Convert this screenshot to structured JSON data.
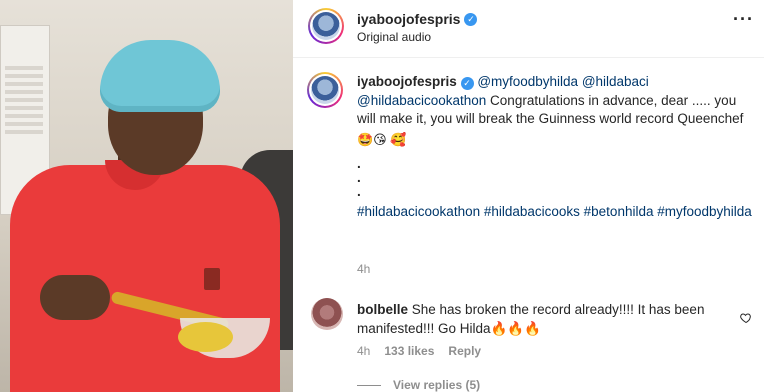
{
  "header": {
    "username": "iyaboojofespris",
    "audio_label": "Original audio",
    "more_label": "···"
  },
  "caption": {
    "username": "iyaboojofespris",
    "mentions": "@myfoodbyhilda @hildabaci @hildabacicookathon",
    "text": " Congratulations in advance, dear ..... you will make it, you will break the Guinness world record Queenchef",
    "emojis": "🤩😘 🥰",
    "dots": [
      ".",
      ".",
      "."
    ],
    "hashtags": "#hildabacicookathon #hildabacicooks #betonhilda #myfoodbyhilda",
    "time": "4h"
  },
  "comment": {
    "username": "bolbelle",
    "text": " She has broken the record already!!!! It has been manifested!!! Go Hilda🔥🔥🔥",
    "time": "4h",
    "likes": "133 likes",
    "reply_label": "Reply"
  },
  "view_replies": {
    "label": "View replies (5)"
  },
  "colors": {
    "link": "#00376b",
    "muted": "#8e8e8e",
    "verified": "#3897f0"
  }
}
